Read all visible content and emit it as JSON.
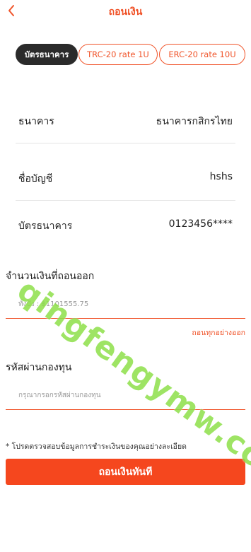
{
  "header": {
    "title": "ถอนเงิน"
  },
  "tabs": [
    {
      "label": "บัตรธนาคาร"
    },
    {
      "label": "TRC-20 rate 1U"
    },
    {
      "label": "ERC-20 rate 10U"
    }
  ],
  "bank_info": {
    "bank": {
      "label": "ธนาคาร",
      "value": "ธนาคารกสิกรไทย"
    },
    "account_name": {
      "label": "ชื่อบัญชี",
      "value": "hshs"
    },
    "card": {
      "label": "บัตรธนาคาร",
      "value": "0123456****"
    }
  },
  "amount": {
    "title": "จำนวนเงินที่ถอนออก",
    "placeholder": "ทั้งปัง : ฿1101555.75",
    "withdraw_all_label": "ถอนทุกอย่างออก"
  },
  "password": {
    "title": "รหัสผ่านกองทุน",
    "placeholder": "กรุณากรอกรหัสผ่านกองทุน"
  },
  "notice": "* โปรดตรวจสอบข้อมูลการชำระเงินของคุณอย่างละเอียด",
  "submit_label": "ถอนเงินทันที",
  "watermark": "qingfengymw.com",
  "colors": {
    "accent": "#f0542a",
    "button": "#f5471e",
    "active_tab": "#2b2b2b"
  }
}
